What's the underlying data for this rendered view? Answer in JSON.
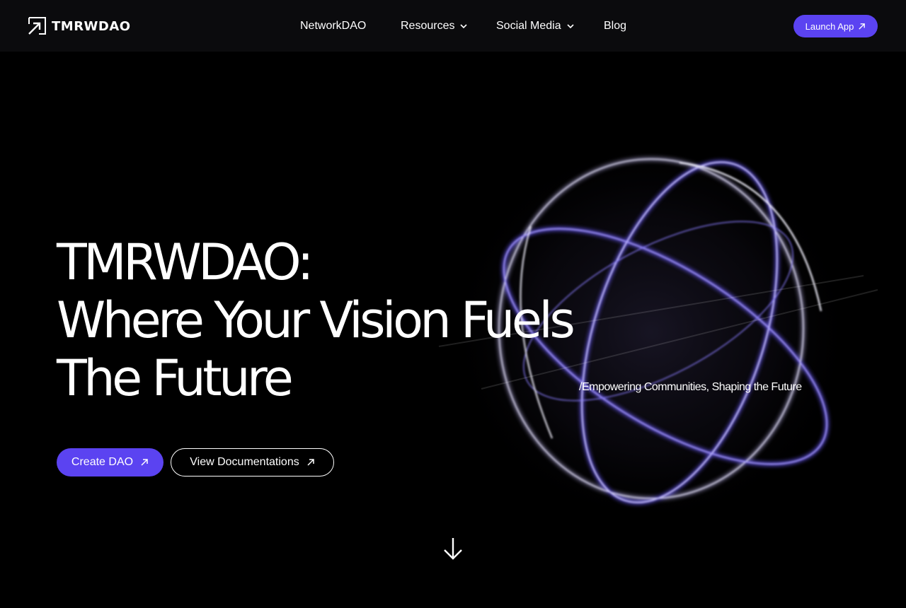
{
  "header": {
    "logo_text": "TMRWDAO",
    "nav": [
      {
        "label": "NetworkDAO",
        "has_dropdown": false
      },
      {
        "label": "Resources",
        "has_dropdown": true
      },
      {
        "label": "Social Media",
        "has_dropdown": true
      },
      {
        "label": "Blog",
        "has_dropdown": false
      }
    ],
    "launch_label": "Launch App"
  },
  "hero": {
    "title_lines": [
      "TMRWDAO:",
      "Where Your Vision Fuels",
      "The Future"
    ],
    "tagline": "/Empowering Communities, Shaping the Future",
    "primary_cta": "Create DAO",
    "secondary_cta": "View Documentations"
  },
  "icons": {
    "logo": "arrow-up-right-logo-icon",
    "dropdown": "chevron-down-icon",
    "external": "arrow-up-right-icon",
    "scroll": "arrow-down-icon"
  },
  "colors": {
    "background": "#000000",
    "header_bg": "#0b0b0d",
    "accent": "#5b43f1",
    "text": "#ffffff"
  }
}
